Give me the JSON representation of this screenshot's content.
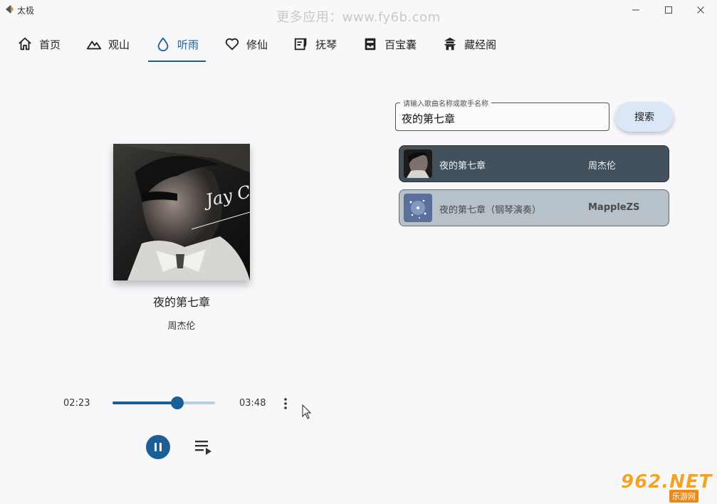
{
  "window": {
    "title": "太极",
    "watermark": "更多应用：www.fy6b.com"
  },
  "nav": {
    "items": [
      {
        "label": "首页",
        "icon": "home-icon"
      },
      {
        "label": "观山",
        "icon": "mountain-icon"
      },
      {
        "label": "听雨",
        "icon": "water-drop-icon",
        "active": true
      },
      {
        "label": "修仙",
        "icon": "heart-icon"
      },
      {
        "label": "抚琴",
        "icon": "music-sheet-icon"
      },
      {
        "label": "百宝囊",
        "icon": "inbox-icon"
      },
      {
        "label": "藏经阁",
        "icon": "pagoda-icon"
      }
    ]
  },
  "now_playing": {
    "title": "夜的第七章",
    "artist": "周杰伦",
    "current_time": "02:23",
    "total_time": "03:48",
    "progress": 0.63,
    "cover_text": "Jay Chou"
  },
  "search": {
    "label": "请输入歌曲名称或歌手名称",
    "value": "夜的第七章",
    "button": "搜索"
  },
  "results": [
    {
      "title": "夜的第七章",
      "artist": "周杰伦"
    },
    {
      "title": "夜的第七章（钢琴演奏）",
      "artist": "MappleZS"
    }
  ],
  "site_watermark": {
    "main": "962.NET",
    "sub": "乐游网"
  },
  "colors": {
    "accent": "#1a5f96",
    "background": "#f8f8fb",
    "result_selected": "#43515c",
    "result_other": "#b7c1ca"
  }
}
